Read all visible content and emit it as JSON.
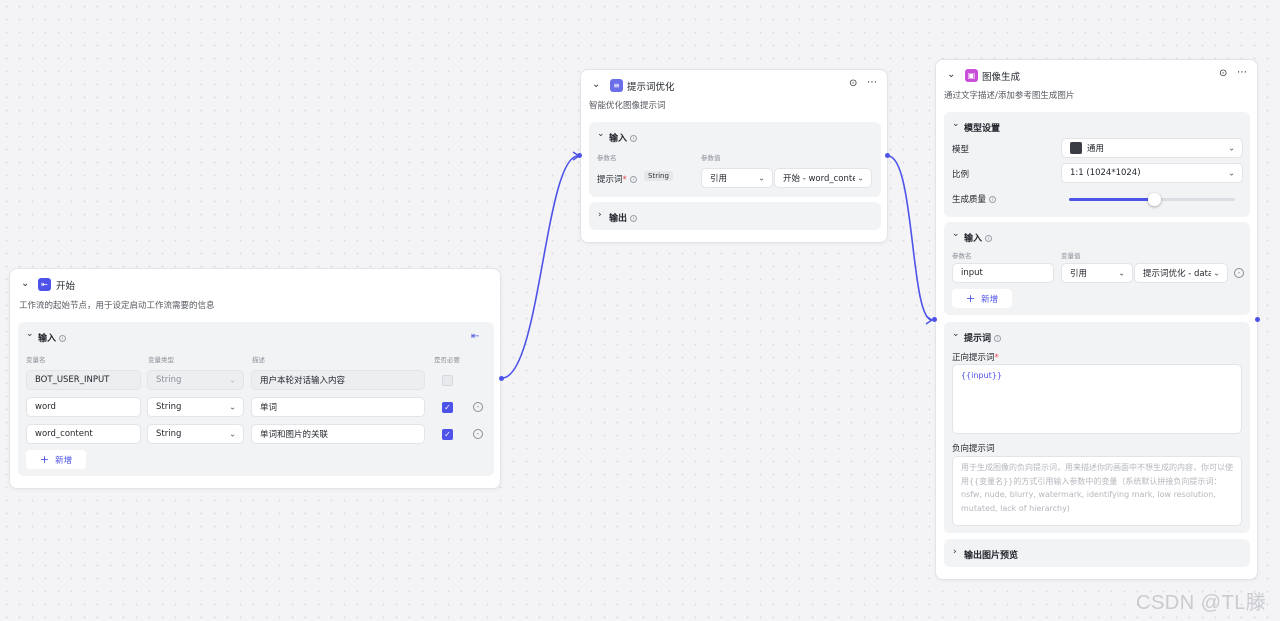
{
  "colors": {
    "accent": "#4d53e8",
    "start_icon": "#4d53e8",
    "prompt_icon": "#6a6ee8",
    "image_icon": "#c84fd8"
  },
  "start": {
    "title": "开始",
    "description": "工作流的起始节点，用于设定启动工作流需要的信息",
    "input_section": "输入",
    "headers": {
      "name": "变量名",
      "type": "变量类型",
      "desc": "描述",
      "required": "是否必要"
    },
    "rows": [
      {
        "name": "BOT_USER_INPUT",
        "type": "String",
        "desc": "用户本轮对话输入内容",
        "required": false
      },
      {
        "name": "word",
        "type": "String",
        "desc": "单词",
        "required": true
      },
      {
        "name": "word_content",
        "type": "String",
        "desc": "单词和图片的关联",
        "required": true
      }
    ],
    "add_label": "新增"
  },
  "prompt": {
    "title": "提示词优化",
    "description": "智能优化图像提示词",
    "input_section": "输入",
    "headers": {
      "param": "参数名",
      "value": "参数值"
    },
    "param_name": "提示词",
    "param_type": "String",
    "ref_mode": "引用",
    "ref_value": "开始 - word_content",
    "output_section": "输出"
  },
  "image": {
    "title": "图像生成",
    "description": "通过文字描述/添加参考图生成图片",
    "model_section": "模型设置",
    "model_label": "模型",
    "model_value": "通用",
    "ratio_label": "比例",
    "ratio_value": "1:1 (1024*1024)",
    "quality_label": "生成质量",
    "quality_fraction": 0.51,
    "input_section": "输入",
    "headers": {
      "param": "参数名",
      "value": "变量值"
    },
    "input_param": "input",
    "ref_mode": "引用",
    "ref_value": "提示词优化 - data",
    "add_label": "新增",
    "prompt_section": "提示词",
    "positive_label": "正向提示词",
    "positive_value": "{{input}}",
    "negative_label": "负向提示词",
    "negative_placeholder": "用于生成图像的负向提示词，用来描述你的画面中不想生成的内容，你可以使用{{变量名}}的方式引用输入参数中的变量（系统默认拼接负向提示词：nsfw, nude, blurry, watermark, identifying mark, low resolution, mutated, lack of hierarchy)",
    "preview_section": "输出图片预览"
  },
  "watermark": "CSDN @TL滕"
}
